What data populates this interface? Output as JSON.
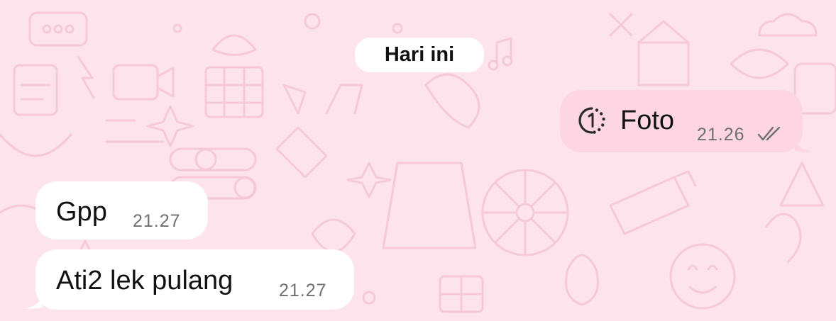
{
  "chat": {
    "date_separator": "Hari ini",
    "messages": [
      {
        "direction": "outgoing",
        "type": "view-once-photo",
        "icon": "view-once-icon",
        "text": "Foto",
        "time": "21.26",
        "status": "read-double-check"
      },
      {
        "direction": "incoming",
        "text": "Gpp",
        "time": "21.27"
      },
      {
        "direction": "incoming",
        "text": "Ati2 lek pulang",
        "time": "21.27"
      }
    ]
  },
  "colors": {
    "wallpaper": "#fde4ec",
    "wallpaper_doodle": "#f6c9d8",
    "outgoing_bubble": "#fdd5e3",
    "incoming_bubble": "#ffffff",
    "time_text": "#707070"
  }
}
